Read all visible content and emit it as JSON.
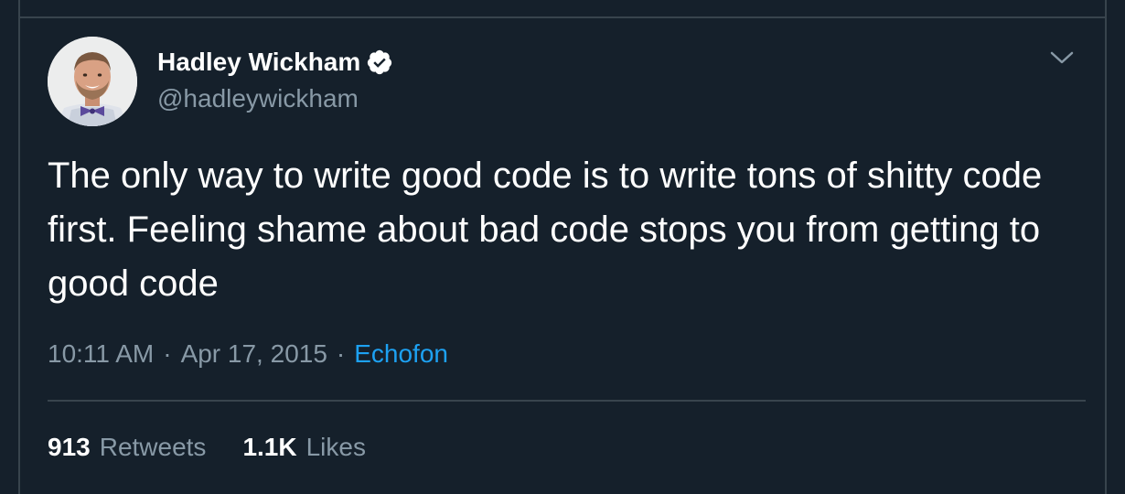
{
  "tweet": {
    "author": {
      "display_name": "Hadley Wickham",
      "handle": "@hadleywickham",
      "verified": true,
      "avatar_icon": "profile-photo"
    },
    "text": "The only way to write good code is to write tons of shitty code first. Feeling shame about bad code stops you from getting to good code",
    "time": "10:11 AM",
    "separator": "·",
    "date": "Apr 17, 2015",
    "source": "Echofon",
    "stats": {
      "retweets_count": "913",
      "retweets_label": "Retweets",
      "likes_count": "1.1K",
      "likes_label": "Likes"
    }
  },
  "icons": {
    "verified": "verified-badge-icon",
    "menu": "chevron-down-icon"
  },
  "colors": {
    "background": "#15202b",
    "border": "#38444d",
    "primary_text": "#ffffff",
    "secondary_text": "#8899a6",
    "accent": "#1da1f2"
  }
}
